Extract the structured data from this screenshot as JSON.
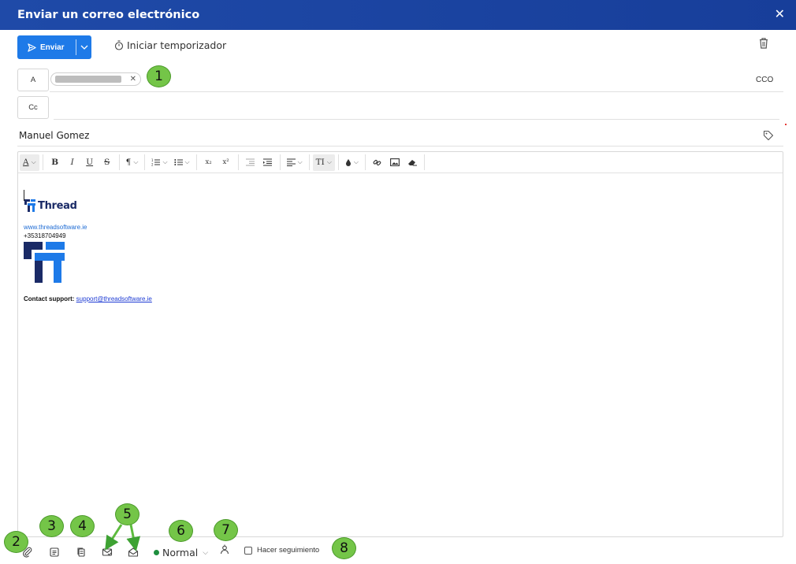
{
  "window": {
    "title": "Enviar un correo electrónico",
    "close_icon": "close-icon"
  },
  "header": {
    "send_label": "Enviar",
    "timer_label": "Iniciar temporizador"
  },
  "recipients": {
    "to_label": "A",
    "cc_label": "Cc",
    "bcc_label": "CCO"
  },
  "subject": {
    "value": "Manuel Gomez"
  },
  "toolbar": {
    "items": [
      "A",
      "B",
      "I",
      "U",
      "S",
      "¶",
      "x₂",
      "x²",
      "TI"
    ],
    "icons": [
      "text-color-icon",
      "bold-icon",
      "italic-icon",
      "underline-icon",
      "strikethrough-icon",
      "paragraph-icon",
      "ordered-list-icon",
      "unordered-list-icon",
      "subscript-icon",
      "superscript-icon",
      "outdent-icon",
      "indent-icon",
      "align-icon",
      "font-size-icon",
      "fill-color-icon",
      "link-icon",
      "image-icon",
      "eraser-icon"
    ]
  },
  "signature": {
    "logo_text": "Thread",
    "website": "www.threadsoftware.ie",
    "phone": "+35318704949",
    "support_label": "Contact support:",
    "support_email": "support@threadsoftware.ie"
  },
  "footer": {
    "priority_value": "Normal",
    "follow_up_label": "Hacer seguimiento",
    "follow_up_checked": false
  },
  "badges": [
    "1",
    "2",
    "3",
    "4",
    "5",
    "6",
    "7",
    "8"
  ],
  "colors": {
    "titlebar": "#1f4aa8",
    "primary": "#1e7ae8",
    "badge": "#74c548",
    "priority_dot": "#1e8e3e",
    "link": "#1d6bd4"
  }
}
